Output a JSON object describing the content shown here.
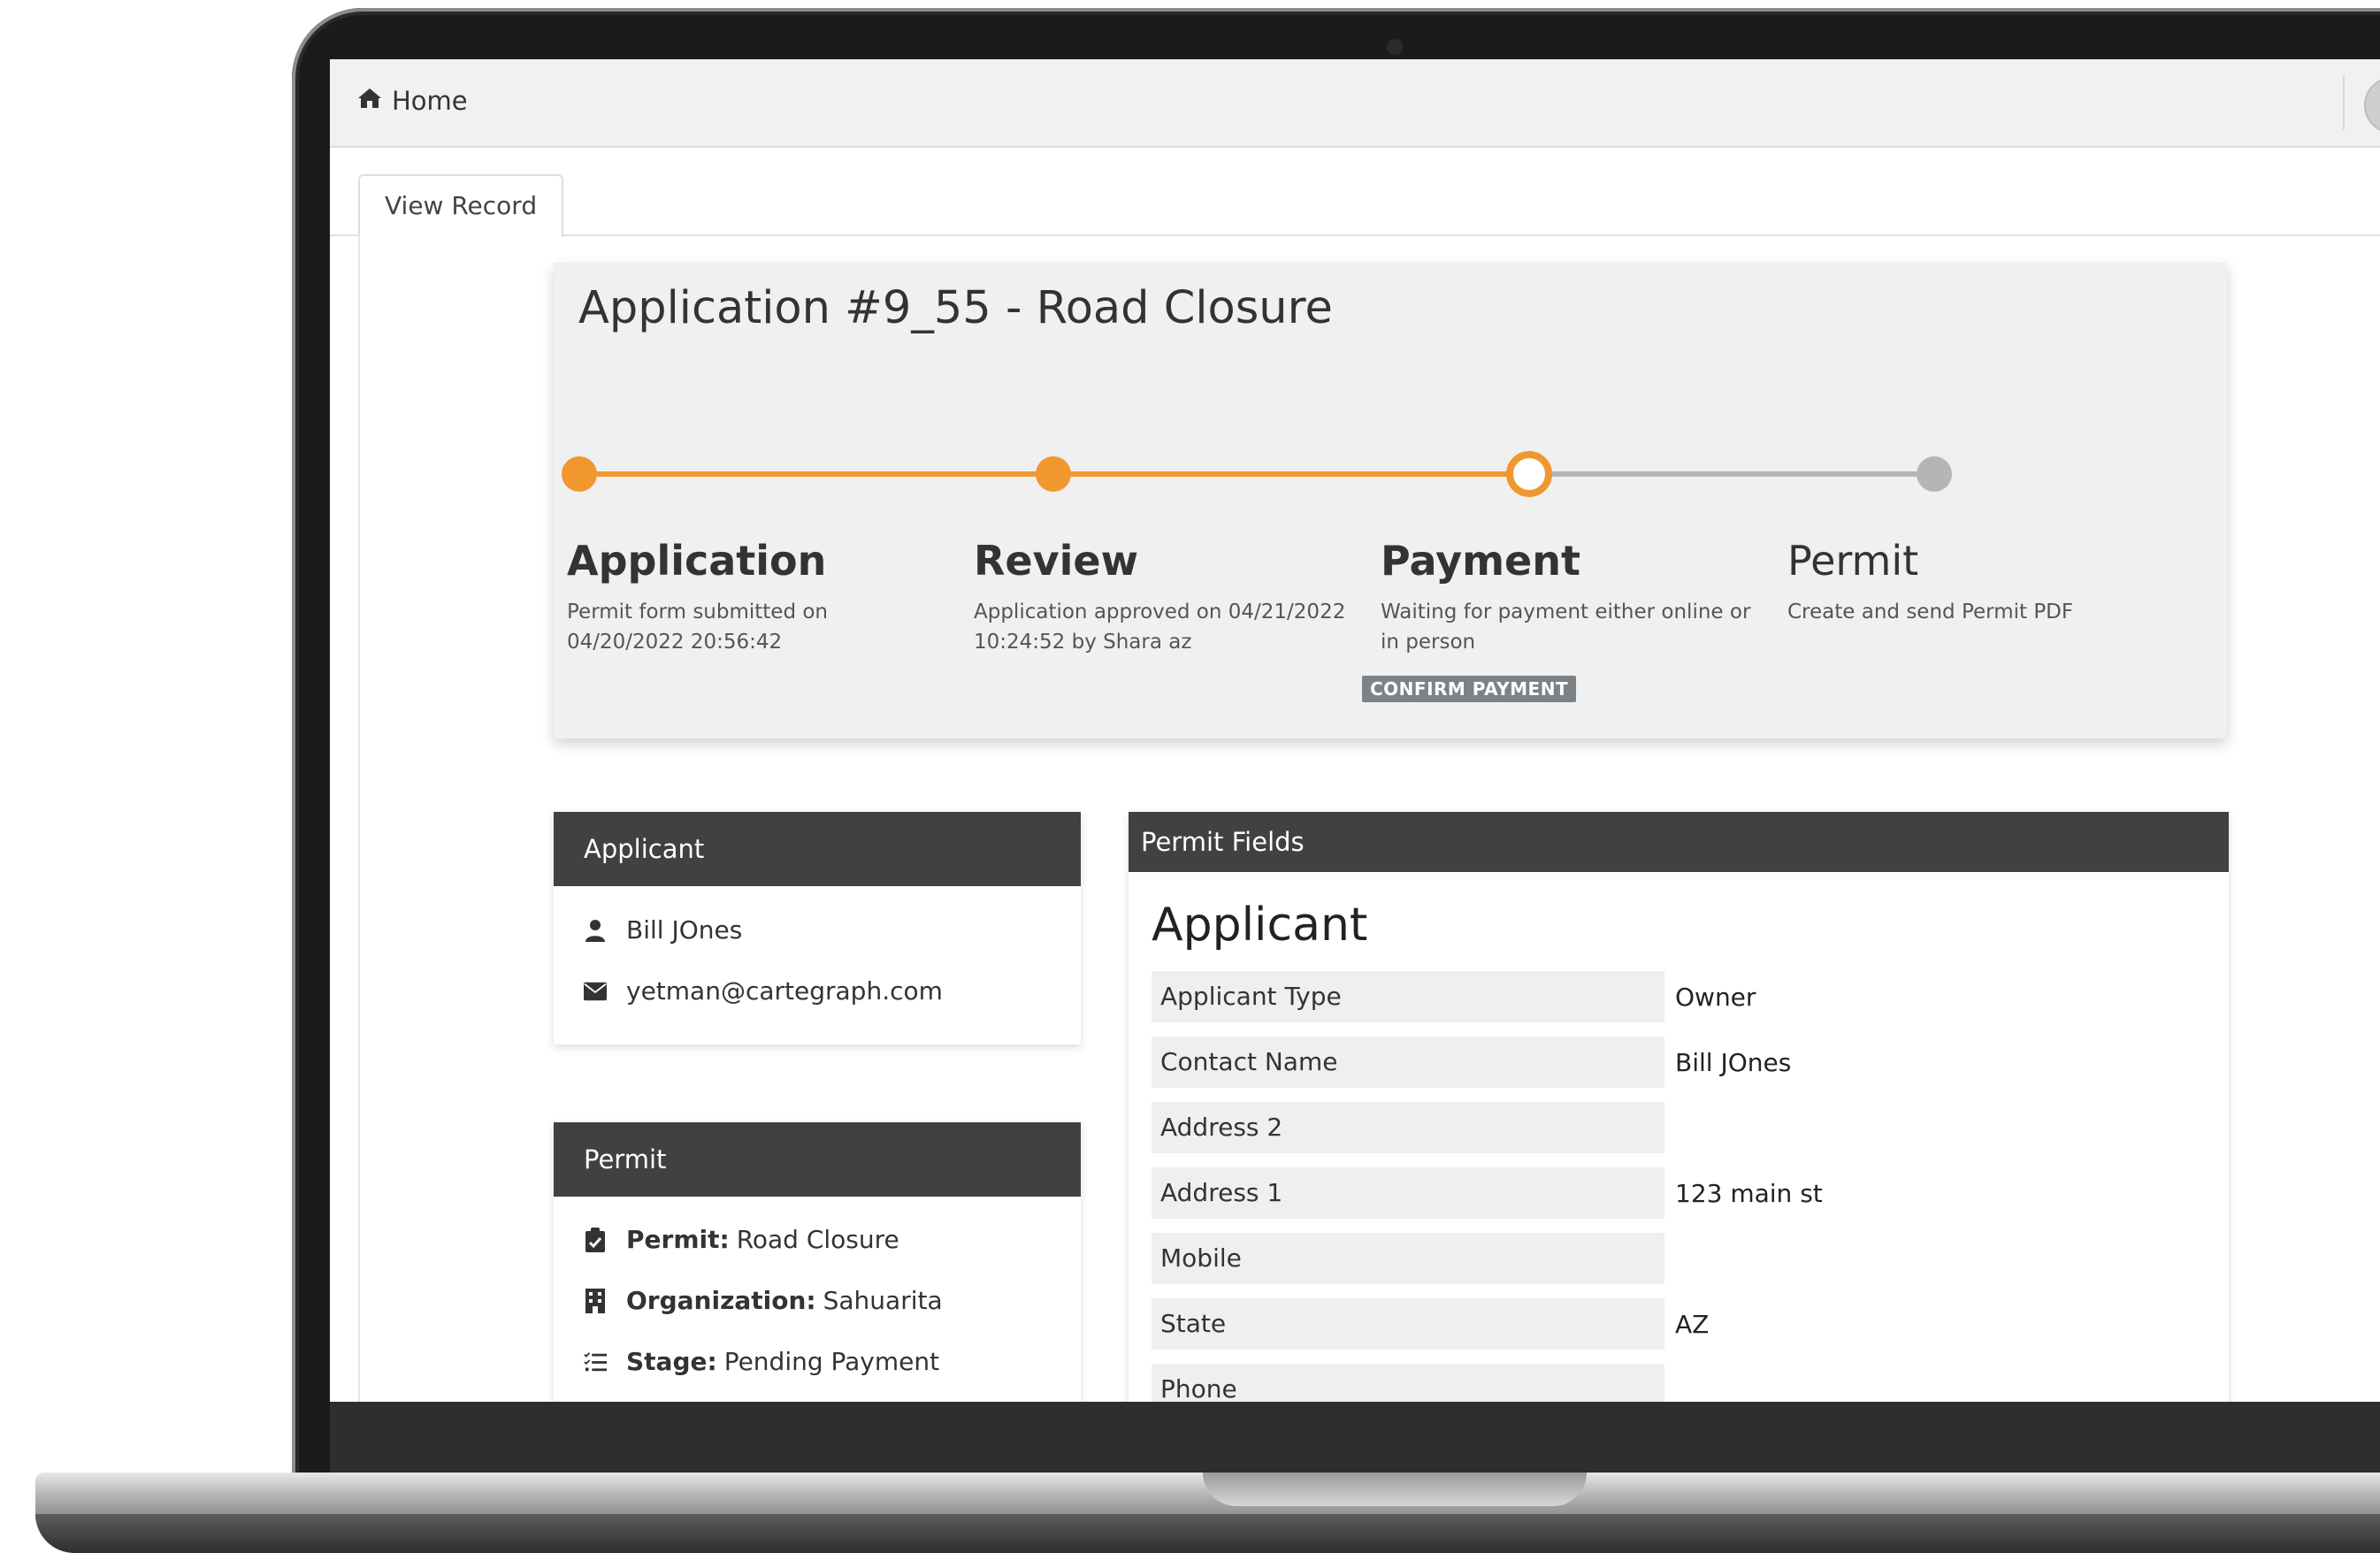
{
  "topbar": {
    "home_label": "Home"
  },
  "tabs": [
    {
      "label": "View Record"
    }
  ],
  "application": {
    "title": "Application #9_55 - Road Closure",
    "steps": [
      {
        "title": "Application",
        "desc": "Permit form submitted on 04/20/2022 20:56:42",
        "state": "done"
      },
      {
        "title": "Review",
        "desc": "Application approved on 04/21/2022 10:24:52 by Shara az",
        "state": "done"
      },
      {
        "title": "Payment",
        "desc": "Waiting for payment either online or in person",
        "state": "current"
      },
      {
        "title": "Permit",
        "desc": "Create and send Permit PDF",
        "state": "pending"
      }
    ],
    "confirm_payment_label": "CONFIRM PAYMENT"
  },
  "applicant_panel": {
    "heading": "Applicant",
    "name": "Bill JOnes",
    "email": "yetman@cartegraph.com"
  },
  "permit_panel": {
    "heading": "Permit",
    "rows": [
      {
        "label": "Permit:",
        "value": "Road Closure",
        "icon": "clipboard-check-icon"
      },
      {
        "label": "Organization:",
        "value": "Sahuarita",
        "icon": "building-icon"
      },
      {
        "label": "Stage:",
        "value": "Pending Payment",
        "icon": "tasks-icon"
      }
    ]
  },
  "fields_panel": {
    "heading": "Permit Fields",
    "section": "Applicant",
    "rows": [
      {
        "label": "Applicant Type",
        "value": "Owner"
      },
      {
        "label": "Contact Name",
        "value": "Bill JOnes"
      },
      {
        "label": "Address 2",
        "value": ""
      },
      {
        "label": "Address 1",
        "value": "123 main st"
      },
      {
        "label": "Mobile",
        "value": ""
      },
      {
        "label": "State",
        "value": "AZ"
      },
      {
        "label": "Phone",
        "value": ""
      }
    ]
  },
  "colors": {
    "accent": "#f0982f",
    "pending": "#b5b5b5",
    "panel_header": "#414141",
    "badge": "#7d8287"
  }
}
